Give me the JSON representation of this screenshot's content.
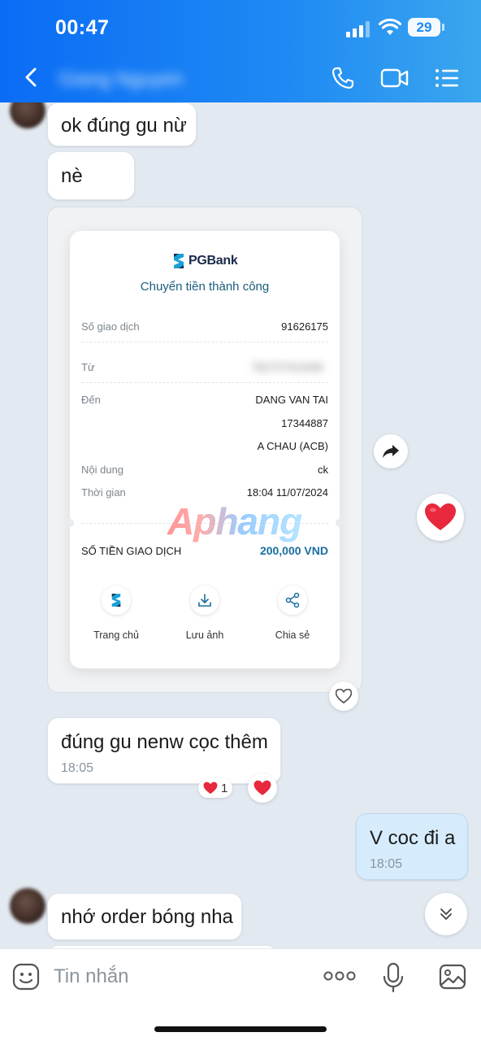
{
  "status_bar": {
    "time": "00:47",
    "battery": "29"
  },
  "header": {
    "contact_name": "Giang Nguyen"
  },
  "messages": {
    "m1": {
      "text": "ok đúng gu nừ"
    },
    "m2": {
      "text": "nè"
    },
    "m4": {
      "text": "đúng gu nenw cọc thêm",
      "time": "18:05",
      "reaction_count": "1"
    },
    "m5": {
      "text": "V coc đi a",
      "time": "18:05"
    },
    "m6": {
      "text": "nhớ order bóng nha"
    }
  },
  "receipt": {
    "bank_name": "PGBank",
    "status": "Chuyển tiền thành công",
    "rows": {
      "txn_id": {
        "label": "Số giao dịch",
        "value": "91626175"
      },
      "from": {
        "label": "Từ",
        "value": "TB2757910068"
      },
      "to": {
        "label": "Đến",
        "name": "DANG VAN TAI",
        "account": "17344887",
        "bank": "A CHAU (ACB)"
      },
      "content": {
        "label": "Nội dung",
        "value": "ck"
      },
      "time": {
        "label": "Thời gian",
        "value": "18:04 11/07/2024"
      }
    },
    "amount_label": "SỐ TIỀN GIAO DỊCH",
    "amount_value": "200,000 VND",
    "actions": {
      "home": "Trang chủ",
      "save": "Lưu ảnh",
      "share": "Chia sẻ"
    }
  },
  "watermark": "Aphang",
  "input": {
    "placeholder": "Tin nhắn"
  },
  "colors": {
    "header_start": "#0a6cf5",
    "header_end": "#3aa6ee",
    "chat_bg": "#e2e9f1",
    "own_bubble": "#d6ecfd",
    "heart": "#e8283c"
  }
}
